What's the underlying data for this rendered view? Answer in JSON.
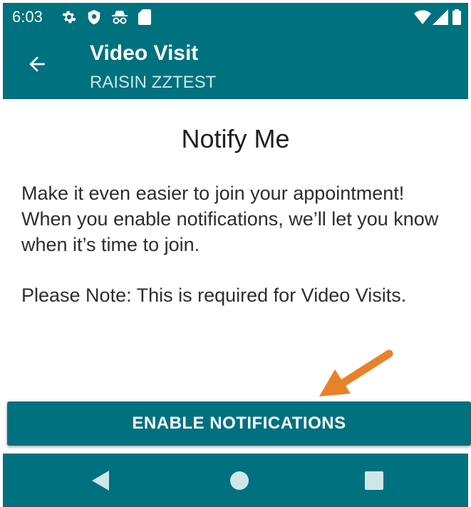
{
  "status_bar": {
    "time": "6:03",
    "left_icons": [
      "gear-icon",
      "shield-icon",
      "incognito-icon",
      "sd-card-icon"
    ],
    "right_icons": [
      "wifi-icon",
      "signal-icon",
      "battery-icon"
    ]
  },
  "app_bar": {
    "title": "Video Visit",
    "subtitle": "RAISIN ZZTEST",
    "back_icon": "arrow-left-icon"
  },
  "content": {
    "title": "Notify Me",
    "body": "Make it even easier to join your appointment! When you enable notifications, we’ll let you know when it’s time to join.",
    "note": "Please Note: This is required for Video Visits."
  },
  "annotation": {
    "arrow_color": "#e8822a"
  },
  "enable_button": {
    "label": "ENABLE NOTIFICATIONS"
  },
  "nav_bar": {
    "items": [
      "back-triangle-icon",
      "home-circle-icon",
      "recents-square-icon"
    ]
  },
  "colors": {
    "primary": "#00717f",
    "on_primary": "#ffffff",
    "text": "#2d2d2d"
  }
}
